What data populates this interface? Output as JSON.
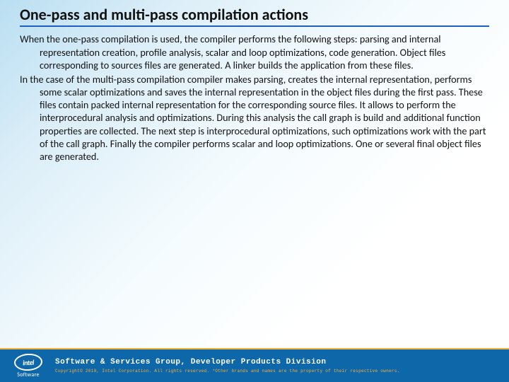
{
  "title": "One-pass and multi-pass compilation actions",
  "paragraphs": [
    "When the one-pass compilation is used, the compiler performs the following steps: parsing and internal representation creation, profile analysis,  scalar and loop optimizations, code generation. Object files corresponding to sources files are generated. A linker builds the application from these files.",
    "In the case of the multi-pass compilation compiler makes parsing, creates the internal representation, performs some scalar optimizations and saves the internal representation in the object files during the first pass. These files contain packed internal representation for the corresponding source files. It allows to perform the interprocedural analysis and optimizations. During this analysis the call graph is build and additional function properties are collected. The next step is interprocedural optimizations, such optimizations work with the part of the call graph. Finally the compiler performs scalar and loop optimizations. One or several final object files are generated."
  ],
  "footer": {
    "logo_brand": "intel",
    "logo_sub": "Software",
    "division": "Software & Services Group, Developer Products Division",
    "copyright": "Copyright© 2010, Intel Corporation. All rights reserved. *Other brands and names are the property of their respective owners."
  }
}
